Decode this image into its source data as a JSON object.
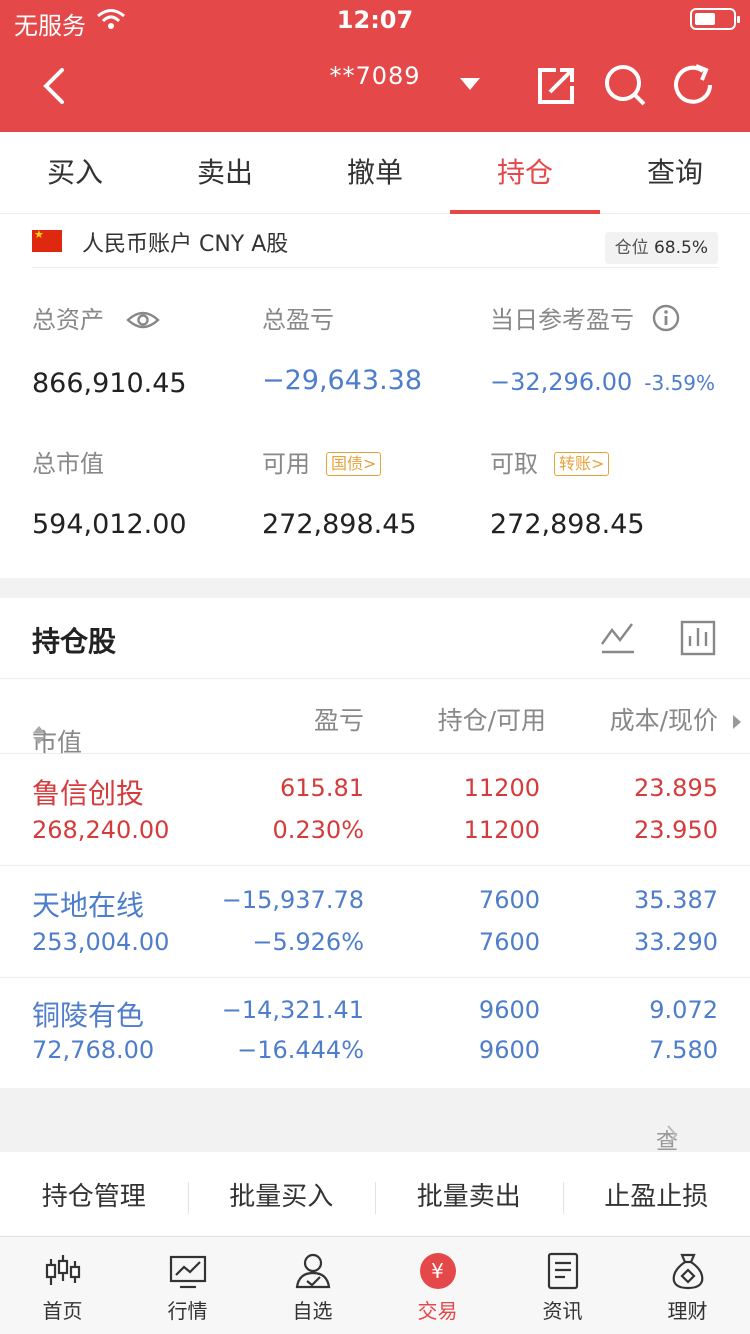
{
  "status_bar": {
    "carrier": "无服务",
    "time": "12:07"
  },
  "nav": {
    "account": "**7089"
  },
  "tabs": [
    "买入",
    "卖出",
    "撤单",
    "持仓",
    "查询"
  ],
  "account": {
    "name": "人民币账户 CNY A股",
    "position_label": "仓位",
    "position_value": "68.5%"
  },
  "summary": {
    "total_assets_label": "总资产",
    "total_assets": "866,910.45",
    "total_pnl_label": "总盈亏",
    "total_pnl": "−29,643.38",
    "daily_pnl_label": "当日参考盈亏",
    "daily_pnl": "−32,296.00",
    "daily_pct": "-3.59%",
    "market_value_label": "总市值",
    "market_value": "594,012.00",
    "available_label": "可用",
    "available_tag": "国债>",
    "available": "272,898.45",
    "withdrawable_label": "可取",
    "withdrawable_tag": "转账>",
    "withdrawable": "272,898.45"
  },
  "holdings": {
    "title": "持仓股",
    "headers": {
      "market_value": "市值",
      "pnl": "盈亏",
      "holding": "持仓/可用",
      "cost": "成本/现价"
    },
    "rows": [
      {
        "name": "鲁信创投",
        "market_value": "268,240.00",
        "pnl": "615.81",
        "pnl_pct": "0.230%",
        "holding": "11200",
        "available": "11200",
        "cost": "23.895",
        "price": "23.950"
      },
      {
        "name": "天地在线",
        "market_value": "253,004.00",
        "pnl": "−15,937.78",
        "pnl_pct": "−5.926%",
        "holding": "7600",
        "available": "7600",
        "cost": "35.387",
        "price": "33.290"
      },
      {
        "name": "铜陵有色",
        "market_value": "72,768.00",
        "pnl": "−14,321.41",
        "pnl_pct": "−16.444%",
        "holding": "9600",
        "available": "9600",
        "cost": "9.072",
        "price": "7.580"
      }
    ],
    "cleared_link": "查看已清仓股票"
  },
  "actions": [
    "持仓管理",
    "批量买入",
    "批量卖出",
    "止盈止损"
  ],
  "tabbar": [
    {
      "label": "首页",
      "icon": "candlestick-icon"
    },
    {
      "label": "行情",
      "icon": "line-chart-icon"
    },
    {
      "label": "自选",
      "icon": "user-check-icon"
    },
    {
      "label": "交易",
      "icon": "yuan-icon",
      "symbol": "¥"
    },
    {
      "label": "资讯",
      "icon": "document-icon"
    },
    {
      "label": "理财",
      "icon": "money-bag-icon"
    }
  ],
  "colors": {
    "brand_red": "#e44848",
    "loss_blue": "#4e7ecb",
    "gain_red": "#d63b3b",
    "tag_orange": "#e6a23c"
  }
}
